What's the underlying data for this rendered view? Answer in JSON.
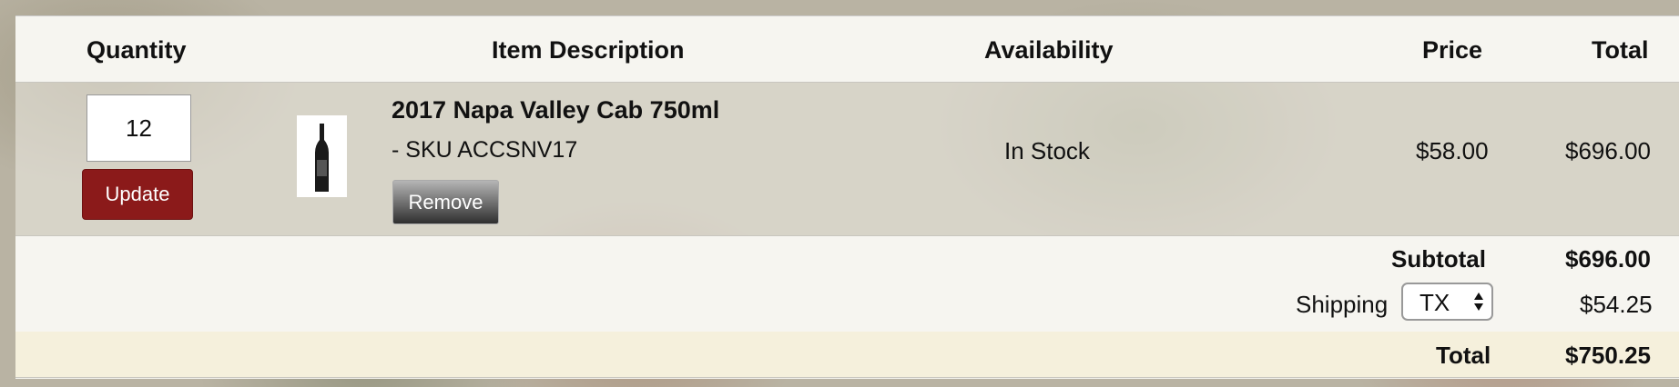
{
  "header": {
    "quantity": "Quantity",
    "item_description": "Item Description",
    "availability": "Availability",
    "price": "Price",
    "total": "Total"
  },
  "item": {
    "quantity": "12",
    "update_label": "Update",
    "title": "2017 Napa Valley Cab 750ml",
    "sku": "- SKU ACCSNV17",
    "remove_label": "Remove",
    "availability": "In Stock",
    "price": "$58.00",
    "total": "$696.00"
  },
  "summary": {
    "subtotal_label": "Subtotal",
    "subtotal_value": "$696.00",
    "shipping_label": "Shipping",
    "shipping_state": "TX",
    "shipping_value": "$54.25",
    "total_label": "Total",
    "total_value": "$750.25"
  },
  "colors": {
    "update_button": "#8b1a1a",
    "total_band": "#f5f0dc"
  },
  "icons": {
    "select_arrows": "up-down-arrows-icon",
    "product_thumbnail": "wine-bottle"
  }
}
